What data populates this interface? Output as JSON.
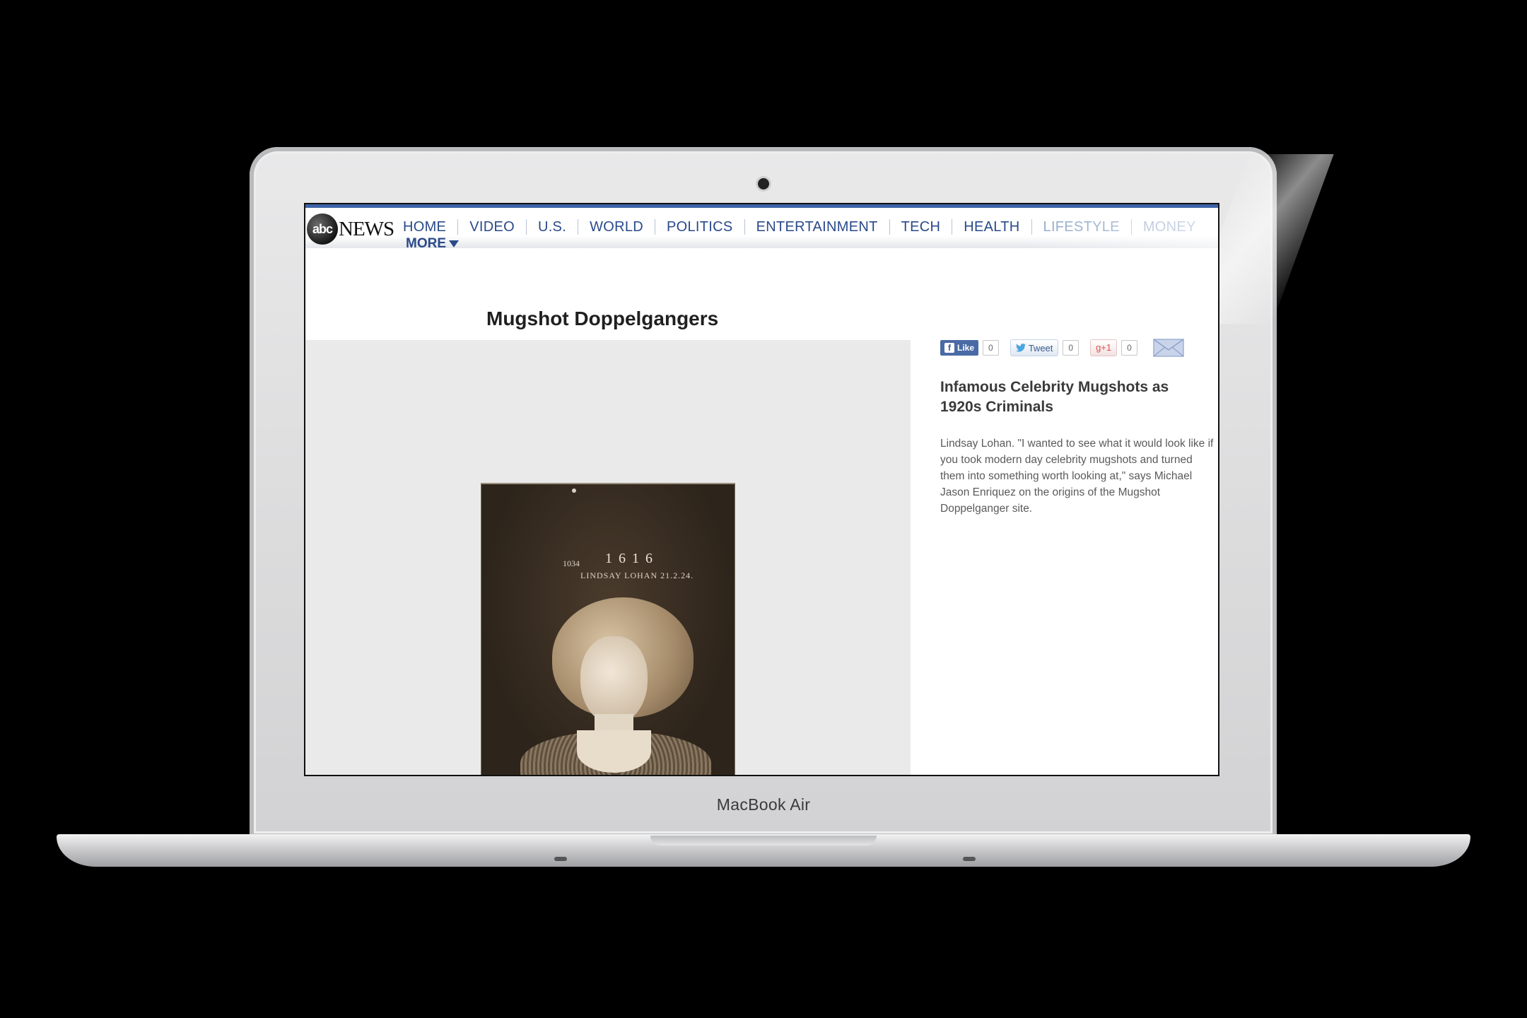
{
  "device": {
    "brand_label": "MacBook Air"
  },
  "header": {
    "logo": {
      "mark": "abc",
      "word": "NEWS"
    },
    "nav": [
      "HOME",
      "VIDEO",
      "U.S.",
      "WORLD",
      "POLITICS",
      "ENTERTAINMENT",
      "TECH",
      "HEALTH",
      "LIFESTYLE",
      "MONEY"
    ],
    "more_label": "MORE"
  },
  "main": {
    "title": "Mugshot Doppelgangers",
    "photo": {
      "number": "1 6 1 6",
      "id": "1034",
      "caption": "LINDSAY LOHAN 21.2.24."
    }
  },
  "sidebar": {
    "share": {
      "like_label": "Like",
      "like_count": "0",
      "tweet_label": "Tweet",
      "tweet_count": "0",
      "gplus_label": "g+1",
      "gplus_count": "0"
    },
    "article_title": "Infamous Celebrity Mugshots as 1920s Criminals",
    "article_text": "Lindsay Lohan. \"I wanted to see what it would look like if you took modern day celebrity mugshots and turned them into something worth looking at,\" says Michael Jason Enriquez on the origins of the Mugshot Doppelganger site."
  },
  "colors": {
    "nav_accent": "#3d64a8",
    "nav_text": "#2a4a8a",
    "facebook": "#4a6aa5"
  }
}
